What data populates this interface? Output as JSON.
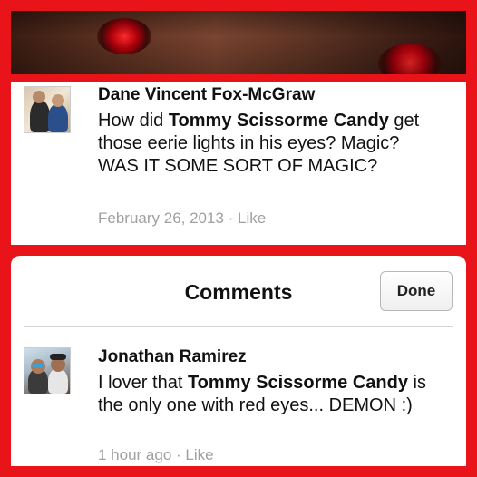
{
  "post": {
    "author": "Dane Vincent Fox-McGraw",
    "text_before": "How did ",
    "text_bold": "Tommy Scissorme Candy",
    "text_after": " get those eerie lights in his eyes? Magic? WAS IT SOME SORT OF MAGIC?",
    "date": "February 26, 2013",
    "separator": " · ",
    "like_label": "Like"
  },
  "comments_panel": {
    "title": "Comments",
    "done_label": "Done"
  },
  "comment": {
    "author": "Jonathan Ramirez",
    "text_before": "I lover that ",
    "text_bold": "Tommy Scissorme Candy",
    "text_after": " is the only one with red eyes... DEMON :)",
    "time": "1 hour ago",
    "separator": " · ",
    "like_label": "Like"
  },
  "colors": {
    "frame": "#e8141a",
    "meta_text": "#a0a0a0"
  }
}
